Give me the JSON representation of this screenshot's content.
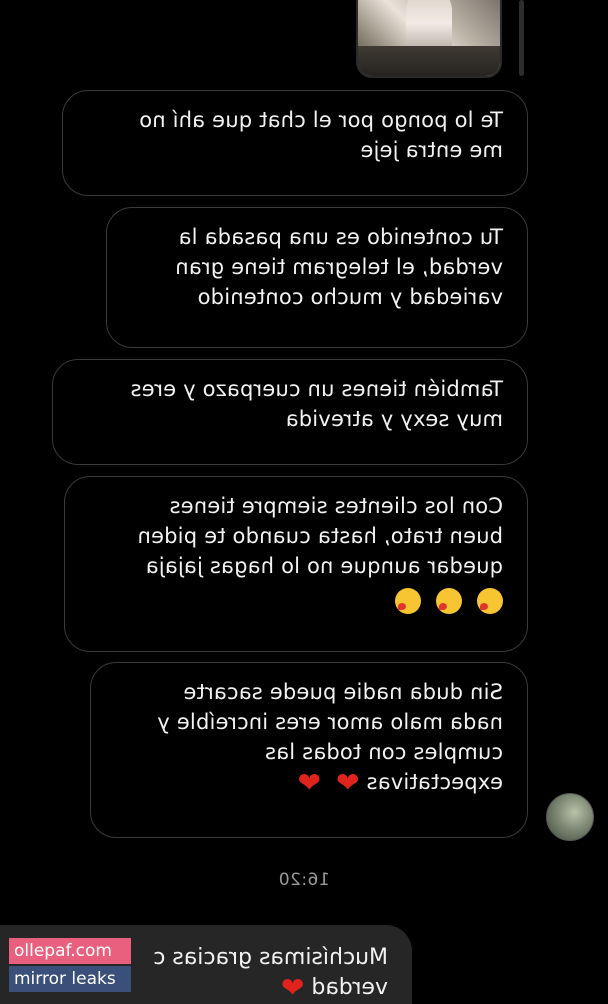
{
  "colors": {
    "background": "#000000",
    "outgoing_bubble_border": "#3a3a3a",
    "incoming_bubble_fill": "#262626",
    "text": "#f2f2f2",
    "timestamp": "#9a9a9a",
    "watermark_line1_bg": "#e9607e",
    "watermark_line2_bg": "#3a4f7a"
  },
  "conversation": {
    "sent_photo_icon": "photo-thumbnail",
    "messages": [
      {
        "lines": [
          "Te lo pongo por el chat que ahí no",
          "me entra jeje"
        ]
      },
      {
        "lines": [
          "Tu contenido es una pasada la",
          "verdad, el telegram tiene gran",
          "variedad y mucho contenido"
        ]
      },
      {
        "lines": [
          "También tienes un cuerpazo y eres",
          "muy sexy y atrevida"
        ]
      },
      {
        "lines": [
          "Con los clientes siempre tienes",
          "buen trato, hasta cuando te piden",
          "quedar aunque no lo hagas jajaja"
        ],
        "emojis": [
          "hand-over-mouth-emoji",
          "kissing-face-emoji",
          "kissing-face-emoji"
        ]
      },
      {
        "lines": [
          "Sin duda nadie puede sacarte",
          "nada malo amor eres increíble y",
          "cumples con todas las",
          "expectativas"
        ],
        "emojis": [
          "red-heart-emoji",
          "red-heart-emoji"
        ]
      }
    ],
    "avatar_icon": "contact-avatar",
    "timestamp": "16:20",
    "reply": {
      "lines": [
        "Muchísimas gracias c",
        "verdad"
      ],
      "emojis": [
        "red-heart-emoji"
      ]
    }
  },
  "watermark": {
    "line1": "ollepaf.com",
    "line2": "mirror leaks"
  }
}
